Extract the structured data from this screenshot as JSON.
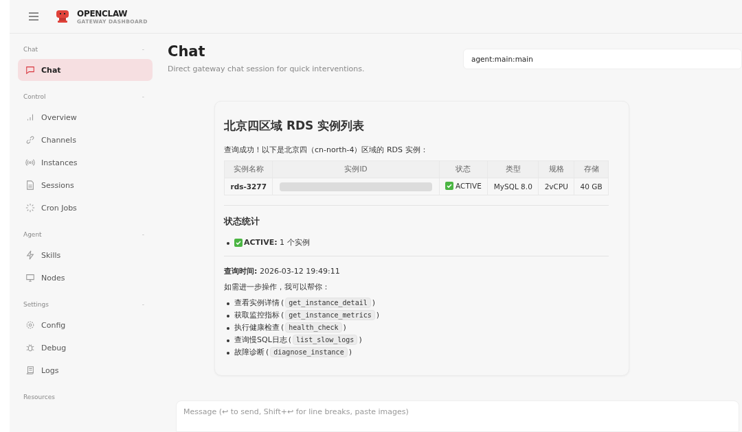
{
  "brand": {
    "name": "OPENCLAW",
    "subtitle": "GATEWAY DASHBOARD"
  },
  "sidebar": [
    {
      "title": "Chat",
      "collapse": "-",
      "items": [
        {
          "label": "Chat",
          "selected": true
        }
      ]
    },
    {
      "title": "Control",
      "collapse": "-",
      "items": [
        {
          "label": "Overview",
          "selected": false
        },
        {
          "label": "Channels",
          "selected": false
        },
        {
          "label": "Instances",
          "selected": false
        },
        {
          "label": "Sessions",
          "selected": false
        },
        {
          "label": "Cron Jobs",
          "selected": false
        }
      ]
    },
    {
      "title": "Agent",
      "collapse": "-",
      "items": [
        {
          "label": "Skills",
          "selected": false
        },
        {
          "label": "Nodes",
          "selected": false
        }
      ]
    },
    {
      "title": "Settings",
      "collapse": "-",
      "items": [
        {
          "label": "Config",
          "selected": false
        },
        {
          "label": "Debug",
          "selected": false
        },
        {
          "label": "Logs",
          "selected": false
        }
      ]
    },
    {
      "title": "Resources"
    }
  ],
  "page": {
    "title": "Chat",
    "subtitle": "Direct gateway chat session for quick interventions.",
    "session": "agent:main:main"
  },
  "message": {
    "heading": "北京四区域 RDS 实例列表",
    "intro": "查询成功！以下是北京四（cn-north-4）区域的 RDS 实例：",
    "table": {
      "columns": [
        "实例名称",
        "实例ID",
        "状态",
        "类型",
        "规格",
        "存储"
      ],
      "rows": [
        {
          "name": "rds-3277",
          "id_redacted": true,
          "status": "ACTIVE",
          "type": "MySQL 8.0",
          "spec": "2vCPU",
          "storage": "40 GB"
        }
      ]
    },
    "stats_heading": "状态统计",
    "stats": [
      "**ACTIVE:** 1 个实例"
    ],
    "query_time": "**查询时间:** 2026-03-12 19:49:11",
    "offer": "如需进一步操作，我可以帮你：",
    "actions": [
      {
        "text": "查看实例详情",
        "open": "(",
        "code": "get_instance_detail",
        "close": ")"
      },
      {
        "text": "获取监控指标",
        "open": "(",
        "code": "get_instance_metrics",
        "close": ")"
      },
      {
        "text": "执行健康检查",
        "open": "(",
        "code": "health_check",
        "close": ")"
      },
      {
        "text": "查询慢SQL日志",
        "open": "(",
        "code": "list_slow_logs",
        "close": ")"
      },
      {
        "text": "故障诊断",
        "open": "(",
        "code": "diagnose_instance",
        "close": ")"
      }
    ]
  },
  "composer": {
    "placeholder": "Message (↩ to send, Shift+↩ for line breaks, paste images)"
  }
}
